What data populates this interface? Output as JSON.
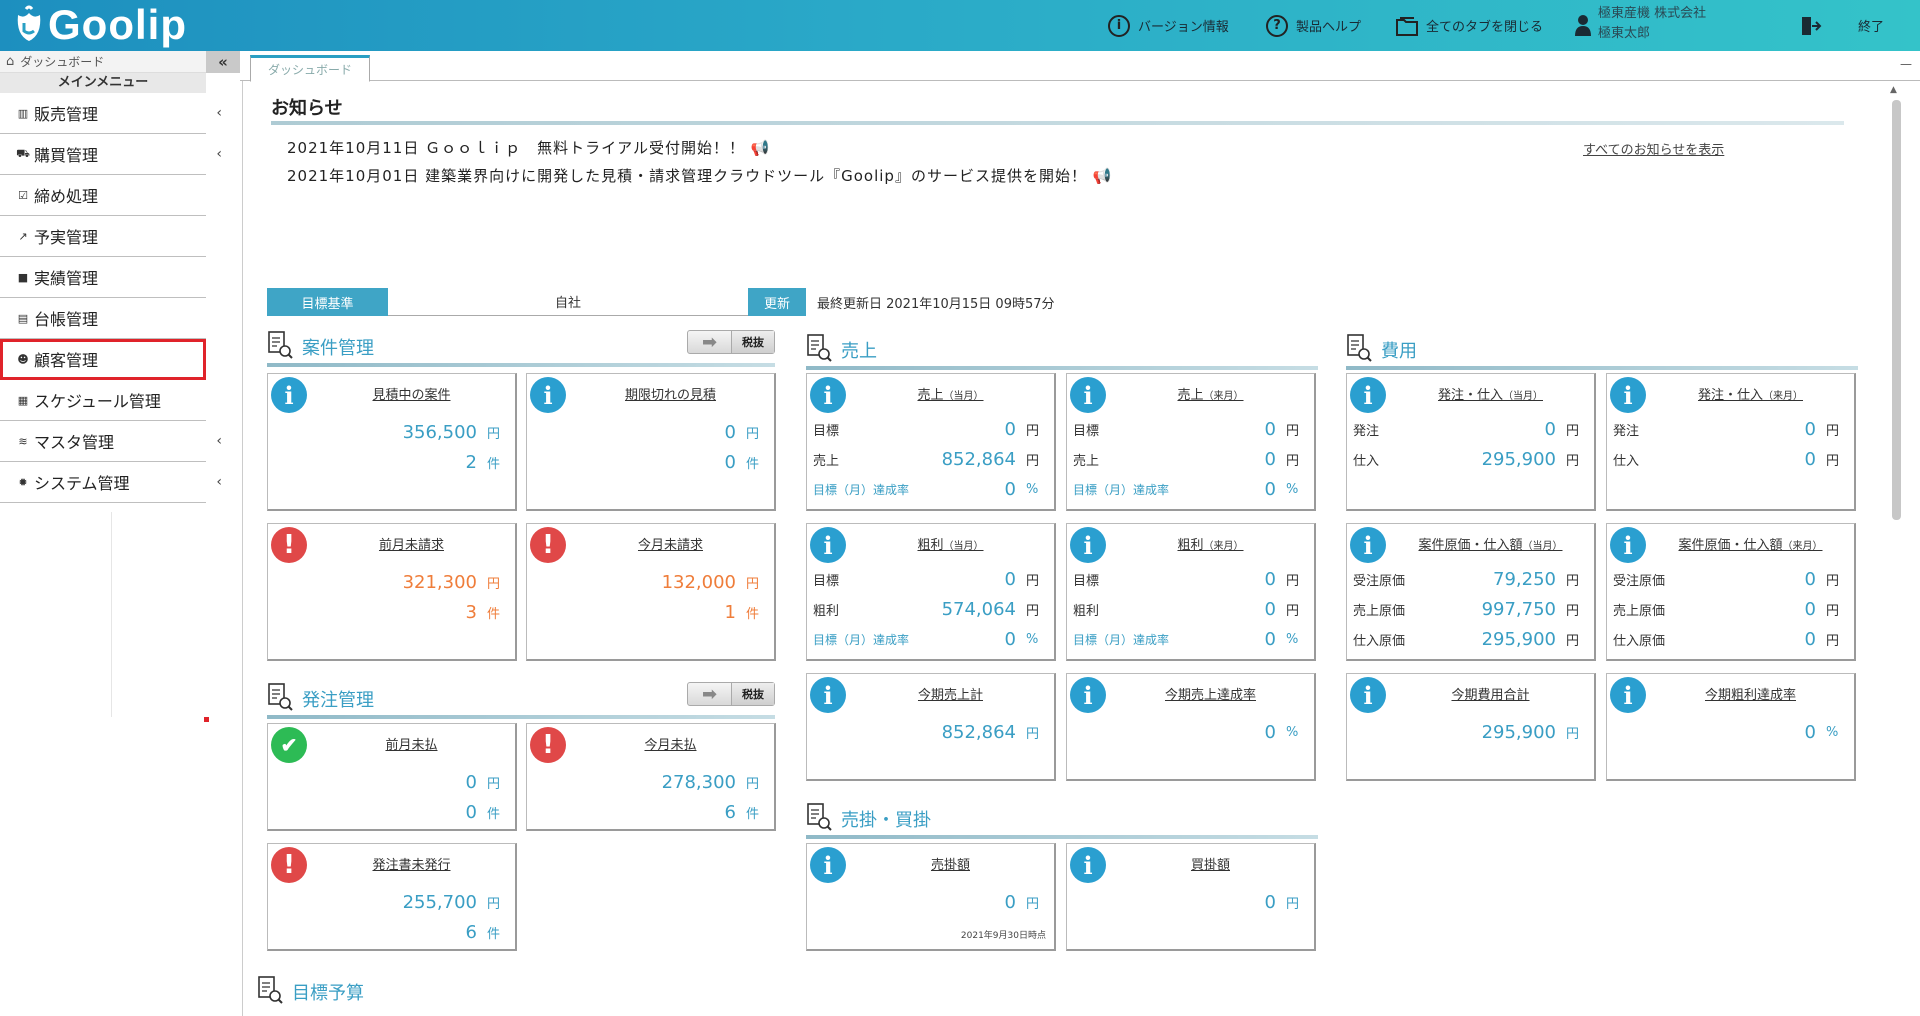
{
  "header": {
    "logo_text": "Goolip",
    "version_label": "バージョン情報",
    "help_label": "製品ヘルプ",
    "close_tabs_label": "全てのタブを閉じる",
    "company": "極東産機 株式会社",
    "user": "極東太郎",
    "exit_label": "終了"
  },
  "sidebar": {
    "breadcrumb": "ダッシュボード",
    "collapse": "«",
    "main_menu": "メインメニュー",
    "items": [
      {
        "label": "販売管理",
        "icon": "▥",
        "chevron": "‹"
      },
      {
        "label": "購買管理",
        "icon": "⛟",
        "chevron": "‹"
      },
      {
        "label": "締め処理",
        "icon": "☑",
        "chevron": ""
      },
      {
        "label": "予実管理",
        "icon": "↗",
        "chevron": ""
      },
      {
        "label": "実績管理",
        "icon": "■",
        "chevron": ""
      },
      {
        "label": "台帳管理",
        "icon": "▤",
        "chevron": ""
      },
      {
        "label": "顧客管理",
        "icon": "☻",
        "chevron": ""
      },
      {
        "label": "スケジュール管理",
        "icon": "▦",
        "chevron": ""
      },
      {
        "label": "マスタ管理",
        "icon": "≋",
        "chevron": "‹"
      },
      {
        "label": "システム管理",
        "icon": "✹",
        "chevron": "‹"
      }
    ]
  },
  "tabs": {
    "active": "ダッシュボード",
    "minimize": "—"
  },
  "news": {
    "title": "お知らせ",
    "items": [
      "2021年10月11日 Ｇｏｏｌｉｐ　無料トライアル受付開始！！ 📢",
      "2021年10月01日 建築業界向けに開発した見積・請求管理クラウドツール『Goolip』のサービス提供を開始！ 📢"
    ],
    "show_all": "すべてのお知らせを表示"
  },
  "target_bar": {
    "label": "目標基準",
    "value": "自社",
    "update": "更新",
    "last_updated": "最終更新日 2021年10月15日 09時57分"
  },
  "sections": {
    "project": "案件管理",
    "sales": "売上",
    "cost": "費用",
    "order": "発注管理",
    "receivable": "売掛・買掛",
    "budget": "目標予算",
    "tax_toggle": "税抜"
  },
  "cards": {
    "estimating": {
      "title": "見積中の案件",
      "amount": "356,500",
      "count": "2"
    },
    "expired": {
      "title": "期限切れの見積",
      "amount": "0",
      "count": "0"
    },
    "prev_unbilled": {
      "title": "前月未請求",
      "amount": "321,300",
      "count": "3"
    },
    "cur_unbilled": {
      "title": "今月未請求",
      "amount": "132,000",
      "count": "1"
    },
    "prev_unpaid": {
      "title": "前月未払",
      "amount": "0",
      "count": "0"
    },
    "cur_unpaid": {
      "title": "今月未払",
      "amount": "278,300",
      "count": "6"
    },
    "po_unissued": {
      "title": "発注書未発行",
      "amount": "255,700",
      "count": "6"
    },
    "sales_cur": {
      "title": "売上",
      "tag": "（当月）",
      "target": "0",
      "actual": "852,864",
      "rate": "0"
    },
    "sales_next": {
      "title": "売上",
      "tag": "（来月）",
      "target": "0",
      "actual": "0",
      "rate": "0"
    },
    "gross_cur": {
      "title": "粗利",
      "tag": "（当月）",
      "target": "0",
      "actual": "574,064",
      "rate": "0"
    },
    "gross_next": {
      "title": "粗利",
      "tag": "（来月）",
      "target": "0",
      "actual": "0",
      "rate": "0"
    },
    "term_sales": {
      "title": "今期売上計",
      "amount": "852,864"
    },
    "term_sales_rate": {
      "title": "今期売上達成率",
      "amount": "0"
    },
    "purchase_cur": {
      "title": "発注・仕入",
      "tag": "（当月）",
      "order": "0",
      "purchase": "295,900"
    },
    "purchase_next": {
      "title": "発注・仕入",
      "tag": "（来月）",
      "order": "0",
      "purchase": "0"
    },
    "cost_cur": {
      "title": "案件原価・仕入額",
      "tag": "（当月）",
      "received": "79,250",
      "sales_cost": "997,750",
      "purchase_cost": "295,900"
    },
    "cost_next": {
      "title": "案件原価・仕入額",
      "tag": "（来月）",
      "received": "0",
      "sales_cost": "0",
      "purchase_cost": "0"
    },
    "term_cost": {
      "title": "今期費用合計",
      "amount": "295,900"
    },
    "term_gross_rate": {
      "title": "今期粗利達成率",
      "amount": "0"
    },
    "receivable": {
      "title": "売掛額",
      "amount": "0",
      "note": "2021年9月30日時点"
    },
    "payable": {
      "title": "買掛額",
      "amount": "0"
    }
  },
  "labels": {
    "yen": "円",
    "ken": "件",
    "pct": "%",
    "target": "目標",
    "sales": "売上",
    "gross": "粗利",
    "rate": "目標（月）達成率",
    "order": "発注",
    "purchase": "仕入",
    "received_cost": "受注原価",
    "sales_cost": "売上原価",
    "purchase_cost": "仕入原価"
  }
}
